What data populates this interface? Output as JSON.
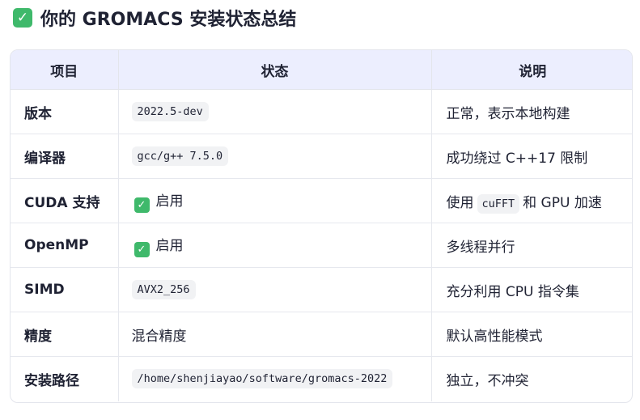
{
  "title": "你的 GROMACS 安装状态总结",
  "headers": [
    "项目",
    "状态",
    "说明"
  ],
  "rows": [
    {
      "item": "版本",
      "status_code": "2022.5-dev",
      "note": "正常，表示本地构建"
    },
    {
      "item": "编译器",
      "status_code": "gcc/g++ 7.5.0",
      "note": "成功绕过 C++17 限制"
    },
    {
      "item": "CUDA 支持",
      "status_text": "启用",
      "status_check": true,
      "note_pre": "使用",
      "note_code": "cuFFT",
      "note_post": "和 GPU 加速"
    },
    {
      "item": "OpenMP",
      "status_text": "启用",
      "status_check": true,
      "note": "多线程并行"
    },
    {
      "item": "SIMD",
      "status_code": "AVX2_256",
      "note": "充分利用 CPU 指令集"
    },
    {
      "item": "精度",
      "status_text": "混合精度",
      "note": "默认高性能模式"
    },
    {
      "item": "安装路径",
      "status_code": "/home/shenjiayao/software/gromacs-2022",
      "note": "独立，不冲突"
    }
  ],
  "colors": {
    "check": "#3fb96b",
    "header_bg": "#eceefe",
    "code_bg": "#f1f2f4"
  }
}
